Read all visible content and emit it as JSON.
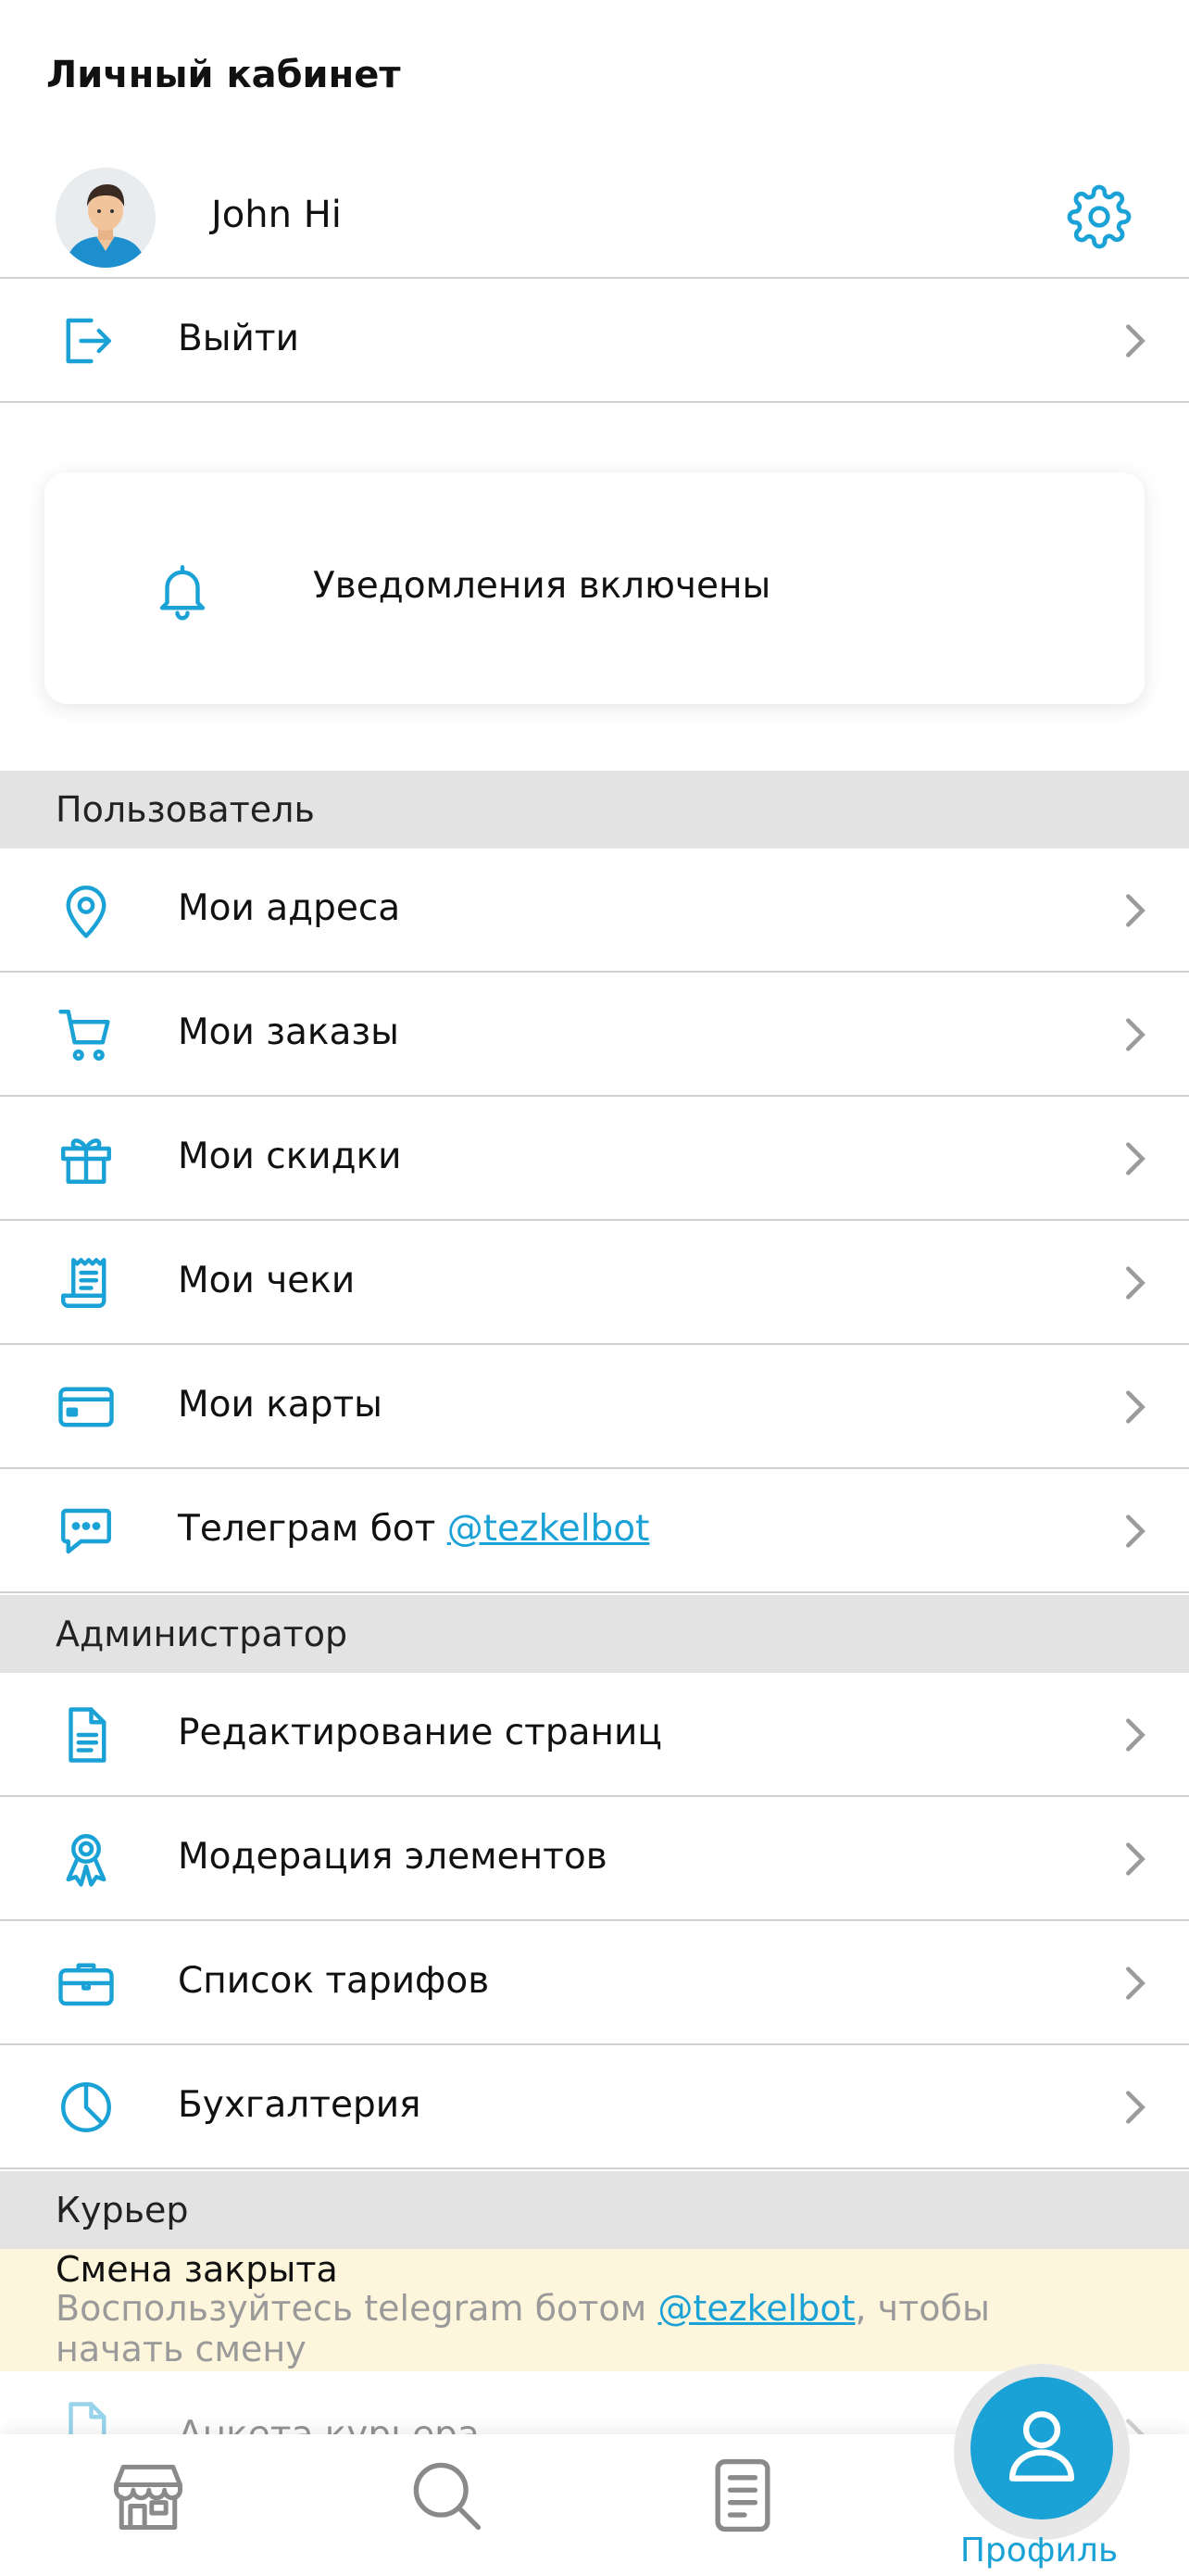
{
  "header": {
    "title": "Личный кабинет"
  },
  "profile": {
    "name": "John Hi"
  },
  "logout": {
    "label": "Выйти"
  },
  "notifications": {
    "label": "Уведомления включены"
  },
  "sections": {
    "user": "Пользователь",
    "admin": "Администратор",
    "courier": "Курьер"
  },
  "user_items": [
    {
      "label": "Мои адреса",
      "icon": "location-pin-icon"
    },
    {
      "label": "Мои заказы",
      "icon": "cart-icon"
    },
    {
      "label": "Мои скидки",
      "icon": "gift-icon"
    },
    {
      "label": "Мои чеки",
      "icon": "receipt-icon"
    },
    {
      "label": "Мои карты",
      "icon": "credit-card-icon"
    },
    {
      "label": "Телеграм бот",
      "link": "@tezkelbot",
      "icon": "chat-bubble-icon"
    }
  ],
  "admin_items": [
    {
      "label": "Редактирование страниц",
      "icon": "document-icon"
    },
    {
      "label": "Модерация элементов",
      "icon": "award-ribbon-icon"
    },
    {
      "label": "Список тарифов",
      "icon": "briefcase-icon"
    },
    {
      "label": "Бухгалтерия",
      "icon": "pie-chart-icon"
    }
  ],
  "courier": {
    "shift_title": "Смена закрыта",
    "shift_text_before": "Воспользуйтесь telegram ботом ",
    "shift_link": "@tezkelbot",
    "shift_text_after": ", чтобы начать смену",
    "form_label": "Анкета курьера"
  },
  "tabbar": {
    "tabs": [
      {
        "name": "shop",
        "icon": "store-icon"
      },
      {
        "name": "search",
        "icon": "search-icon"
      },
      {
        "name": "orders",
        "icon": "document-list-icon"
      }
    ],
    "active_label": "Профиль"
  },
  "colors": {
    "accent": "#1aa2d6",
    "section_bg": "#e3e3e3",
    "banner_bg": "#fdf6dc",
    "text": "#111111",
    "muted": "#9a9a9a"
  }
}
